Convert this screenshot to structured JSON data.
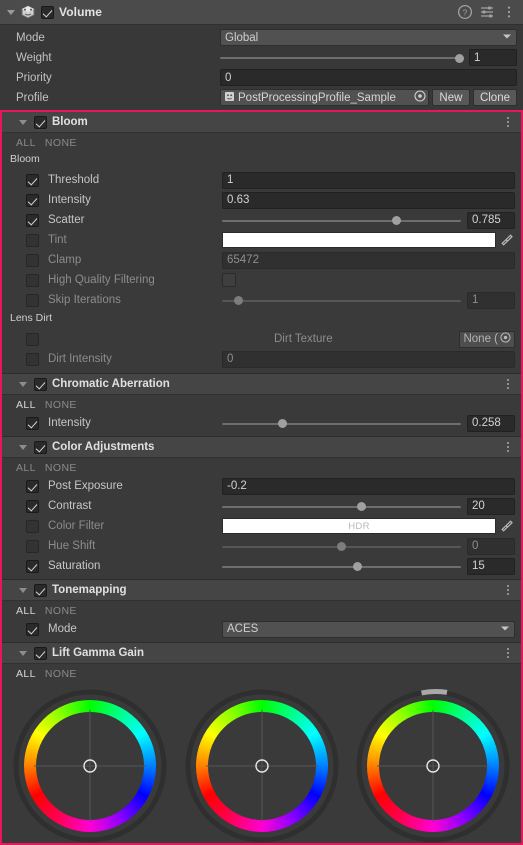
{
  "component": {
    "title": "Volume",
    "icon": "volume-component-icon",
    "enabled": true,
    "expanded": true,
    "header_icons": [
      "help-icon",
      "preset-icon",
      "kebab-menu-icon"
    ]
  },
  "properties": [
    {
      "label": "Mode",
      "type": "dropdown",
      "value": "Global"
    },
    {
      "label": "Weight",
      "type": "slider",
      "value": "1",
      "fill": 0.985
    },
    {
      "label": "Priority",
      "type": "number",
      "value": "0"
    },
    {
      "label": "Profile",
      "type": "object",
      "value": "PostProcessingProfile_Sample",
      "buttons": [
        "New",
        "Clone"
      ]
    }
  ],
  "effects": [
    {
      "name": "Bloom",
      "enabled": true,
      "expanded": true,
      "all_label": "ALL",
      "none_label": "NONE",
      "all_active": false,
      "none_active": false,
      "groups": [
        {
          "title": "Bloom",
          "rows": [
            {
              "label": "Threshold",
              "override": true,
              "type": "number",
              "value": "1"
            },
            {
              "label": "Intensity",
              "override": true,
              "type": "number",
              "value": "0.63"
            },
            {
              "label": "Scatter",
              "override": true,
              "type": "slider",
              "value": "0.785",
              "fill": 0.73
            },
            {
              "label": "Tint",
              "override": false,
              "type": "color",
              "value": "",
              "color": "#ffffff"
            },
            {
              "label": "Clamp",
              "override": false,
              "type": "number",
              "value": "65472",
              "dim": true
            },
            {
              "label": "High Quality Filtering",
              "override": false,
              "type": "bool",
              "value": ""
            },
            {
              "label": "Skip Iterations",
              "override": false,
              "type": "slider",
              "value": "1",
              "fill": 0.07,
              "dim": true
            }
          ]
        },
        {
          "title": "Lens Dirt",
          "rows": [
            {
              "label": "Dirt Texture",
              "override": false,
              "type": "object-none",
              "value": "None (",
              "label_right": true
            },
            {
              "label": "Dirt Intensity",
              "override": false,
              "type": "number",
              "value": "0",
              "dim": true
            }
          ]
        }
      ]
    },
    {
      "name": "Chromatic Aberration",
      "enabled": true,
      "expanded": true,
      "all_label": "ALL",
      "none_label": "NONE",
      "all_active": true,
      "none_active": false,
      "groups": [
        {
          "title": "",
          "rows": [
            {
              "label": "Intensity",
              "override": true,
              "type": "slider",
              "value": "0.258",
              "fill": 0.255
            }
          ]
        }
      ]
    },
    {
      "name": "Color Adjustments",
      "enabled": true,
      "expanded": true,
      "all_label": "ALL",
      "none_label": "NONE",
      "all_active": false,
      "none_active": false,
      "groups": [
        {
          "title": "",
          "rows": [
            {
              "label": "Post Exposure",
              "override": true,
              "type": "number",
              "value": "-0.2"
            },
            {
              "label": "Contrast",
              "override": true,
              "type": "slider",
              "value": "20",
              "fill": 0.585
            },
            {
              "label": "Color Filter",
              "override": false,
              "type": "color",
              "value": "HDR",
              "color": "#ffffff"
            },
            {
              "label": "Hue Shift",
              "override": false,
              "type": "slider",
              "value": "0",
              "fill": 0.5,
              "dim": true
            },
            {
              "label": "Saturation",
              "override": true,
              "type": "slider",
              "value": "15",
              "fill": 0.565
            }
          ]
        }
      ]
    },
    {
      "name": "Tonemapping",
      "enabled": true,
      "expanded": true,
      "all_label": "ALL",
      "none_label": "NONE",
      "all_active": true,
      "none_active": false,
      "groups": [
        {
          "title": "",
          "rows": [
            {
              "label": "Mode",
              "override": true,
              "type": "dropdown",
              "value": "ACES"
            }
          ]
        }
      ]
    },
    {
      "name": "Lift Gamma Gain",
      "enabled": true,
      "expanded": true,
      "all_label": "ALL",
      "none_label": "NONE",
      "all_active": true,
      "none_active": false,
      "wheels": [
        {
          "name": "lift-wheel",
          "arc": 0.0
        },
        {
          "name": "gamma-wheel",
          "arc": 0.0
        },
        {
          "name": "gain-wheel",
          "arc": 0.09
        }
      ]
    }
  ],
  "colors": {
    "accent_border": "#e8175d",
    "panel_bg": "#383838",
    "header_bg": "#4b4b4b",
    "section_bg": "#454545",
    "field_bg": "#2a2a2a",
    "text": "#c4c4c4"
  }
}
